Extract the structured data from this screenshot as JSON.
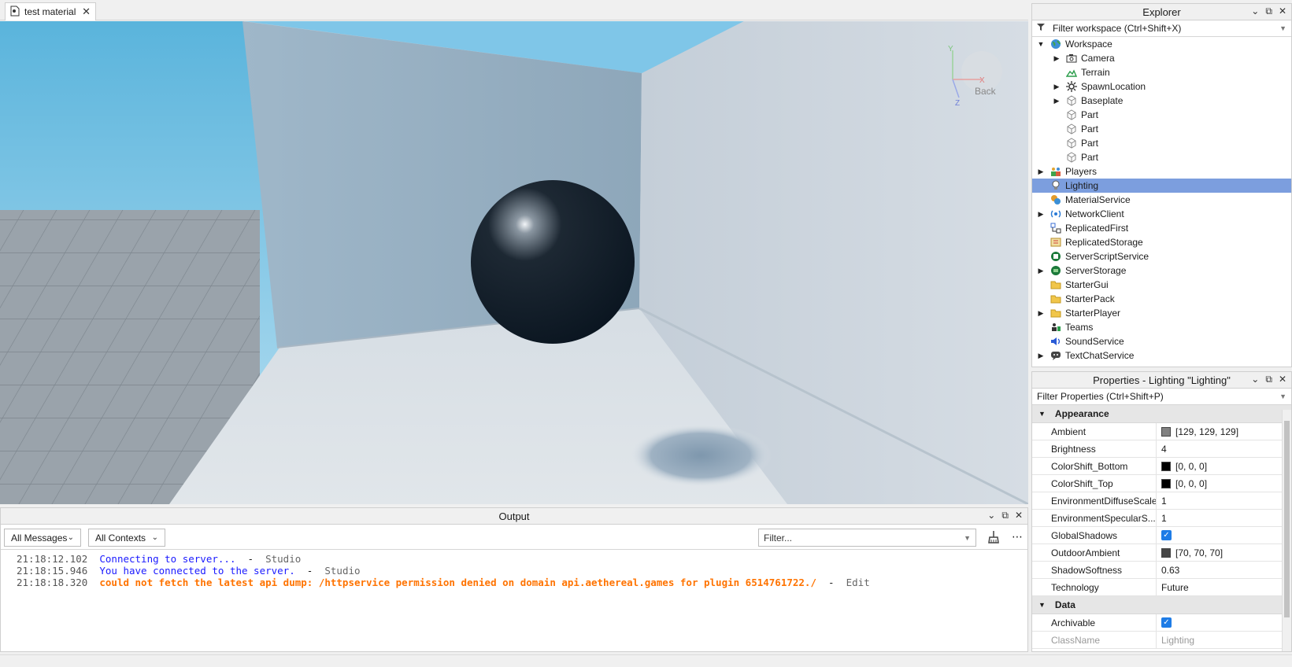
{
  "tab": {
    "title": "test material",
    "close": "✕"
  },
  "viewport": {
    "view_cube_label": "Back",
    "axis_y": "Y",
    "axis_x": "X",
    "axis_z": "Z"
  },
  "output": {
    "title": "Output",
    "messages_filter": "All Messages",
    "contexts_filter": "All Contexts",
    "filter_placeholder": "Filter...",
    "lines": [
      {
        "time": "21:18:12.102",
        "text": "Connecting to server...",
        "source": "Studio",
        "color": "blue"
      },
      {
        "time": "21:18:15.946",
        "text": "You have connected to the server.",
        "source": "Studio",
        "color": "blue"
      },
      {
        "time": "21:18:18.320",
        "text": "could not fetch the latest api dump: /httpservice permission denied on domain api.aethereal.games for plugin 6514761722./",
        "source": "Edit",
        "color": "orange"
      }
    ]
  },
  "explorer": {
    "title": "Explorer",
    "filter_placeholder": "Filter workspace (Ctrl+Shift+X)",
    "items": [
      {
        "label": "Workspace",
        "depth": 0,
        "expand": "open",
        "icon": "globe"
      },
      {
        "label": "Camera",
        "depth": 1,
        "expand": "closed",
        "icon": "camera"
      },
      {
        "label": "Terrain",
        "depth": 1,
        "expand": "none",
        "icon": "terrain"
      },
      {
        "label": "SpawnLocation",
        "depth": 1,
        "expand": "closed",
        "icon": "gear"
      },
      {
        "label": "Baseplate",
        "depth": 1,
        "expand": "closed",
        "icon": "cube"
      },
      {
        "label": "Part",
        "depth": 1,
        "expand": "none",
        "icon": "cube"
      },
      {
        "label": "Part",
        "depth": 1,
        "expand": "none",
        "icon": "cube"
      },
      {
        "label": "Part",
        "depth": 1,
        "expand": "none",
        "icon": "cube"
      },
      {
        "label": "Part",
        "depth": 1,
        "expand": "none",
        "icon": "cube"
      },
      {
        "label": "Players",
        "depth": 0,
        "expand": "closed",
        "icon": "players"
      },
      {
        "label": "Lighting",
        "depth": 0,
        "expand": "none",
        "icon": "bulb",
        "selected": true
      },
      {
        "label": "MaterialService",
        "depth": 0,
        "expand": "none",
        "icon": "material"
      },
      {
        "label": "NetworkClient",
        "depth": 0,
        "expand": "closed",
        "icon": "network"
      },
      {
        "label": "ReplicatedFirst",
        "depth": 0,
        "expand": "none",
        "icon": "replicated"
      },
      {
        "label": "ReplicatedStorage",
        "depth": 0,
        "expand": "none",
        "icon": "storage"
      },
      {
        "label": "ServerScriptService",
        "depth": 0,
        "expand": "none",
        "icon": "script-service"
      },
      {
        "label": "ServerStorage",
        "depth": 0,
        "expand": "closed",
        "icon": "server-storage"
      },
      {
        "label": "StarterGui",
        "depth": 0,
        "expand": "none",
        "icon": "folder"
      },
      {
        "label": "StarterPack",
        "depth": 0,
        "expand": "none",
        "icon": "folder"
      },
      {
        "label": "StarterPlayer",
        "depth": 0,
        "expand": "closed",
        "icon": "folder"
      },
      {
        "label": "Teams",
        "depth": 0,
        "expand": "none",
        "icon": "teams"
      },
      {
        "label": "SoundService",
        "depth": 0,
        "expand": "none",
        "icon": "sound"
      },
      {
        "label": "TextChatService",
        "depth": 0,
        "expand": "closed",
        "icon": "chat"
      }
    ]
  },
  "properties": {
    "title": "Properties - Lighting \"Lighting\"",
    "filter_placeholder": "Filter Properties (Ctrl+Shift+P)",
    "categories": [
      {
        "name": "Appearance",
        "rows": [
          {
            "name": "Ambient",
            "value": "[129, 129, 129]",
            "swatch": "#818181"
          },
          {
            "name": "Brightness",
            "value": "4"
          },
          {
            "name": "ColorShift_Bottom",
            "value": "[0, 0, 0]",
            "swatch": "#000000"
          },
          {
            "name": "ColorShift_Top",
            "value": "[0, 0, 0]",
            "swatch": "#000000"
          },
          {
            "name": "EnvironmentDiffuseScale",
            "value": "1"
          },
          {
            "name": "EnvironmentSpecularS...",
            "value": "1"
          },
          {
            "name": "GlobalShadows",
            "value": "",
            "checked": true
          },
          {
            "name": "OutdoorAmbient",
            "value": "[70, 70, 70]",
            "swatch": "#464646"
          },
          {
            "name": "ShadowSoftness",
            "value": "0.63"
          },
          {
            "name": "Technology",
            "value": "Future"
          }
        ]
      },
      {
        "name": "Data",
        "rows": [
          {
            "name": "Archivable",
            "value": "",
            "checked": true
          },
          {
            "name": "ClassName",
            "value": "Lighting",
            "muted": true
          }
        ]
      }
    ]
  },
  "colors": {
    "selection": "#7c9ede",
    "accent": "#1e7ce6",
    "log_blue": "#1a1aff",
    "log_orange": "#ff7300"
  }
}
